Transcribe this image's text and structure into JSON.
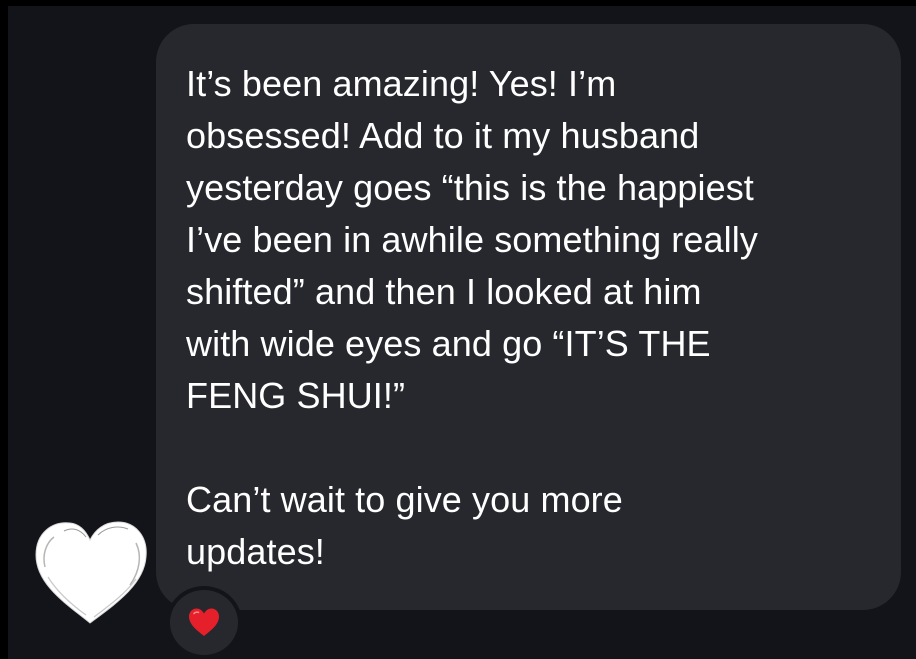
{
  "message": {
    "paragraph1": "It’s been amazing! Yes! I’m\nobsessed! Add to it my husband\nyesterday goes “this is the happiest\nI’ve been in awhile something really\nshifted” and then I looked at him\nwith wide eyes and go “IT’S THE\nFENG SHUI!”",
    "paragraph2": "Can’t wait to give you more\nupdates!"
  },
  "avatar": {
    "icon": "white-heart-icon",
    "color": "#ffffff"
  },
  "reaction": {
    "icon": "red-heart-icon",
    "color": "#e5202a"
  },
  "colors": {
    "background": "#121419",
    "bubble": "#26282d",
    "text": "#ffffff"
  }
}
